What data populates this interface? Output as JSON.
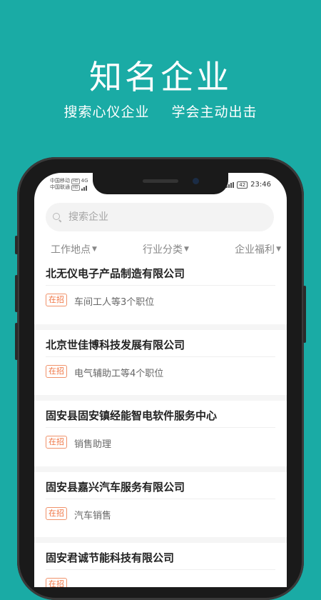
{
  "hero": {
    "title": "知名企业",
    "subtitle_left": "搜索心仪企业",
    "subtitle_right": "学会主动出击"
  },
  "status_bar": {
    "carrier_1": "中国移动",
    "carrier_2": "中国联通",
    "hd_label": "HD",
    "net": "4G",
    "battery": "42",
    "time": "23:46"
  },
  "search": {
    "placeholder": "搜索企业"
  },
  "filters": [
    {
      "label": "工作地点"
    },
    {
      "label": "行业分类"
    },
    {
      "label": "企业福利"
    }
  ],
  "companies": [
    {
      "name": "北无仪电子产品制造有限公司",
      "tag": "在招",
      "jobs": "车间工人等3个职位"
    },
    {
      "name": "北京世佳博科技发展有限公司",
      "tag": "在招",
      "jobs": "电气辅助工等4个职位"
    },
    {
      "name": "固安县固安镇经能智电软件服务中心",
      "tag": "在招",
      "jobs": "销售助理"
    },
    {
      "name": "固安县嘉兴汽车服务有限公司",
      "tag": "在招",
      "jobs": "汽车销售"
    },
    {
      "name": "固安君诚节能科技有限公司",
      "tag": "在招",
      "jobs": ""
    }
  ],
  "colors": {
    "background": "#1aaba5",
    "tag": "#f07340"
  }
}
